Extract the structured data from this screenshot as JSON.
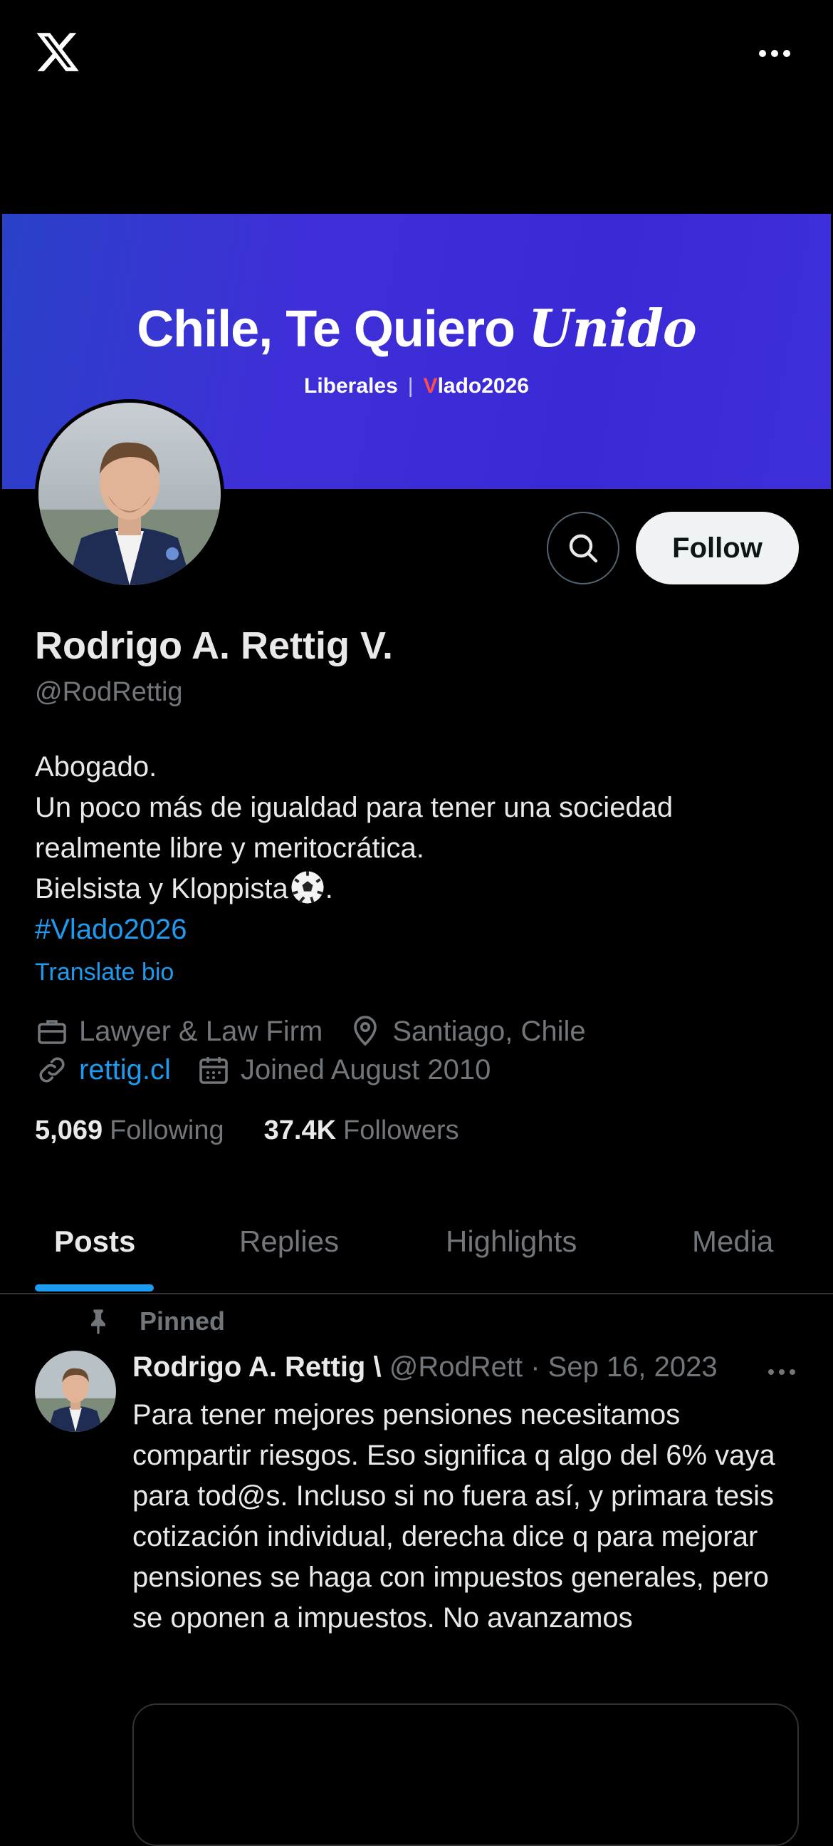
{
  "header": {
    "logo_icon": "x-logo-icon",
    "more_icon": "more-horizontal-icon"
  },
  "banner": {
    "title_main": "Chile, Te Quiero ",
    "title_script": "Unido",
    "sub_left": "Liberales",
    "sub_sep": "|",
    "sub_right_v": "V",
    "sub_right_rest": "lado2026",
    "colors": {
      "from": "#2a41c8",
      "to": "#3a2ad6"
    }
  },
  "profile": {
    "name": "Rodrigo A. Rettig V.",
    "handle": "@RodRettig",
    "bio": [
      "Abogado.",
      "Un poco más de igualdad para tener una sociedad realmente libre y meritocrática.",
      "Bielsista y Kloppista",
      "."
    ],
    "hashtag": "#Vlado2026",
    "translate_label": "Translate bio",
    "category": "Lawyer & Law Firm",
    "location": "Santiago, Chile",
    "website": "rettig.cl",
    "joined": "Joined August 2010",
    "following_count": "5,069",
    "following_label": "Following",
    "followers_count": "37.4K",
    "followers_label": "Followers",
    "follow_button": "Follow"
  },
  "tabs": [
    {
      "label": "Posts",
      "active": true
    },
    {
      "label": "Replies",
      "active": false
    },
    {
      "label": "Highlights",
      "active": false
    },
    {
      "label": "Media",
      "active": false
    }
  ],
  "pinned_post": {
    "pinned_label": "Pinned",
    "author_name": "Rodrigo A. Rettig \\",
    "author_handle": "@RodRett",
    "separator": "·",
    "date": "Sep 16, 2023",
    "text": "Para tener mejores pensiones necesitamos compartir riesgos. Eso significa q algo del 6% vaya para tod@s. Incluso si no fuera así, y primara tesis cotización individual, derecha dice q para mejorar pensiones se haga con impuestos generales, pero se oponen a impuestos. No avanzamos"
  },
  "accent": "#1d9bf0"
}
